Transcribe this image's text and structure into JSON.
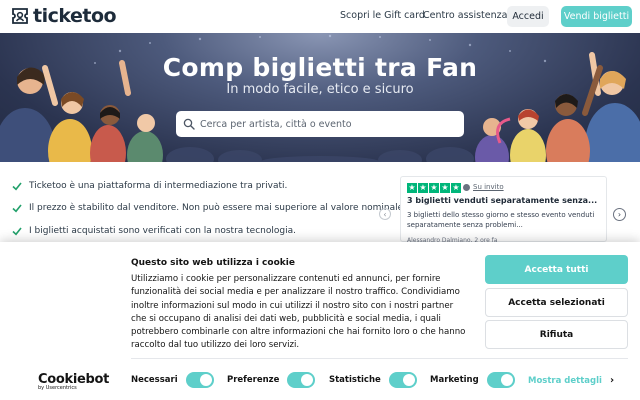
{
  "header": {
    "logo_text": "ticketoo",
    "nav": {
      "gift_card": "Scopri le Gift card",
      "help": "Centro assistenza"
    },
    "login_label": "Accedi",
    "sell_label": "Vendi biglietti"
  },
  "hero": {
    "title": "Comp biglietti tra Fan",
    "subtitle": "In modo facile, etico e sicuro",
    "search_placeholder": "Cerca per artista, città o evento"
  },
  "features": [
    "Ticketoo è una piattaforma di intermediazione tra privati.",
    "Il prezzo è stabilito dal venditore. Non può essere mai superiore al valore nominale.",
    "I biglietti acquistati sono verificati con la nostra tecnologia."
  ],
  "review": {
    "rating_stars": 5,
    "invited_label": "Su invito",
    "title": "3 biglietti venduti separatamente senza...",
    "body": "3 biglietti dello stesso giorno e stesso evento venduti separatamente senza problemi...",
    "author": "Alessandro Dalmiano, 2 ore fa"
  },
  "cookie": {
    "title": "Questo sito web utilizza i cookie",
    "text": "Utilizziamo i cookie per personalizzare contenuti ed annunci, per fornire funzionalità dei social media e per analizzare il nostro traffico. Condividiamo inoltre informazioni sul modo in cui utilizzi il nostro sito con i nostri partner che si occupano di analisi dei dati web, pubblicità e social media, i quali potrebbero combinarle con altre informazioni che hai fornito loro o che hanno raccolto dal tuo utilizzo dei loro servizi.",
    "accept_all": "Accetta tutti",
    "accept_selected": "Accetta selezionati",
    "reject": "Rifiuta",
    "brand": "Cookiebot",
    "brand_by": "by Usercentrics",
    "toggles": [
      {
        "label": "Necessari",
        "on": true
      },
      {
        "label": "Preferenze",
        "on": true
      },
      {
        "label": "Statistiche",
        "on": true
      },
      {
        "label": "Marketing",
        "on": true
      }
    ],
    "details_label": "Mostra dettagli"
  },
  "colors": {
    "accent": "#5ecfca",
    "trustpilot": "#00b67a",
    "text": "#1f2a37"
  }
}
